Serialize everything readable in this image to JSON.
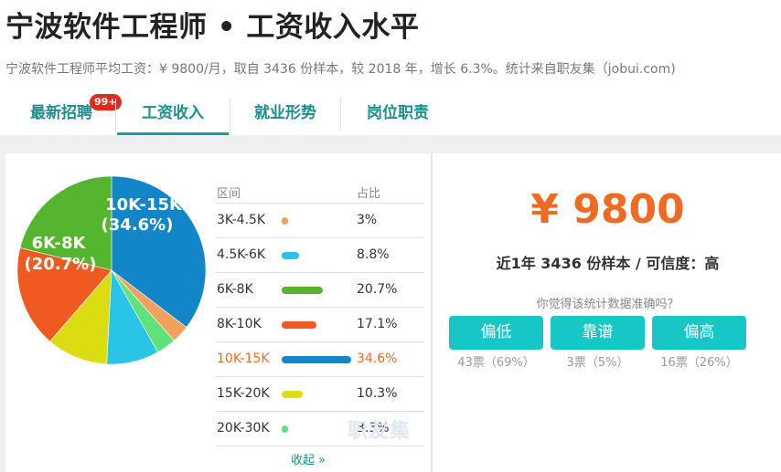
{
  "header": {
    "title": "宁波软件工程师 • 工资收入水平",
    "subtitle": "宁波软件工程师平均工资：¥ 9800/月，取自 3436 份样本，较 2018 年，增长 6.3%。统计来自职友集（jobui.com)"
  },
  "tabs": [
    {
      "label": "最新招聘",
      "badge": "99+",
      "active": false
    },
    {
      "label": "工资收入",
      "active": true
    },
    {
      "label": "就业形势",
      "active": false
    },
    {
      "label": "岗位职责",
      "active": false
    }
  ],
  "table": {
    "col_range": "区间",
    "col_pct": "占比",
    "rows": [
      {
        "range": "3K-4.5K",
        "pct": "3%",
        "value": 3.0,
        "color": "#f5a05a",
        "highlight": false
      },
      {
        "range": "4.5K-6K",
        "pct": "8.8%",
        "value": 8.8,
        "color": "#2ac4e6",
        "highlight": false
      },
      {
        "range": "6K-8K",
        "pct": "20.7%",
        "value": 20.7,
        "color": "#56b52f",
        "highlight": false
      },
      {
        "range": "8K-10K",
        "pct": "17.1%",
        "value": 17.1,
        "color": "#f0591f",
        "highlight": false
      },
      {
        "range": "10K-15K",
        "pct": "34.6%",
        "value": 34.6,
        "color": "#1286c8",
        "highlight": true
      },
      {
        "range": "15K-20K",
        "pct": "10.3%",
        "value": 10.3,
        "color": "#dcdc12",
        "highlight": false
      },
      {
        "range": "20K-30K",
        "pct": "3.3%",
        "value": 3.3,
        "color": "#5fe27a",
        "highlight": false
      }
    ],
    "collapse_label": "收起 »"
  },
  "pie_labels": [
    {
      "range": "10K-15K",
      "pct": "(34.6%)"
    },
    {
      "range": "6K-8K",
      "pct": "(20.7%)"
    }
  ],
  "watermark": "职友集",
  "summary": {
    "avg_salary": "¥ 9800",
    "meta": "近1年 3436 份样本 / 可信度：高",
    "question": "你觉得该统计数据准确吗？",
    "votes": [
      {
        "label": "偏低",
        "count": "43票（69%）"
      },
      {
        "label": "靠谱",
        "count": "3票（5%）"
      },
      {
        "label": "偏高",
        "count": "16票（26%）"
      }
    ]
  }
}
